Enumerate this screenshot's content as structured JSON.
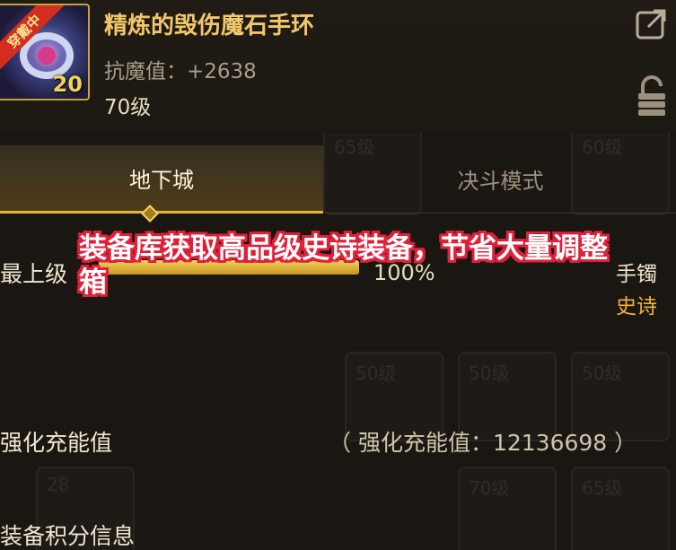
{
  "item": {
    "name": "精炼的毁伤魔石手环",
    "stat": "抗魔值：+2638",
    "level": "70级",
    "count": "20",
    "ribbon": "穿戴中"
  },
  "icons": {
    "export": "export-icon",
    "lock": "lock-icon"
  },
  "tabs": [
    {
      "label": "地下城",
      "active": true
    },
    {
      "label": "决斗模式",
      "active": false
    }
  ],
  "rows": {
    "top_label": "最上级",
    "progress_text": "100%",
    "progress_fraction": 1.0,
    "slot_type": "手镯",
    "slot_rarity": "史诗",
    "charge_label": "强化充能值",
    "charge_value": "（ 强化充能值：12136698 ）",
    "score_label": "装备积分信息"
  },
  "background_slots": [
    "65级",
    "60级",
    "50级",
    "50级",
    "50级",
    "70级",
    "65级",
    "28"
  ],
  "overlay": {
    "caption": "装备库获取高品级史诗装备，节省大量调整箱"
  },
  "colors": {
    "accent_gold": "#f2c76a",
    "rarity_epic": "#f0b43a",
    "caption_outline": "#e0203a"
  }
}
